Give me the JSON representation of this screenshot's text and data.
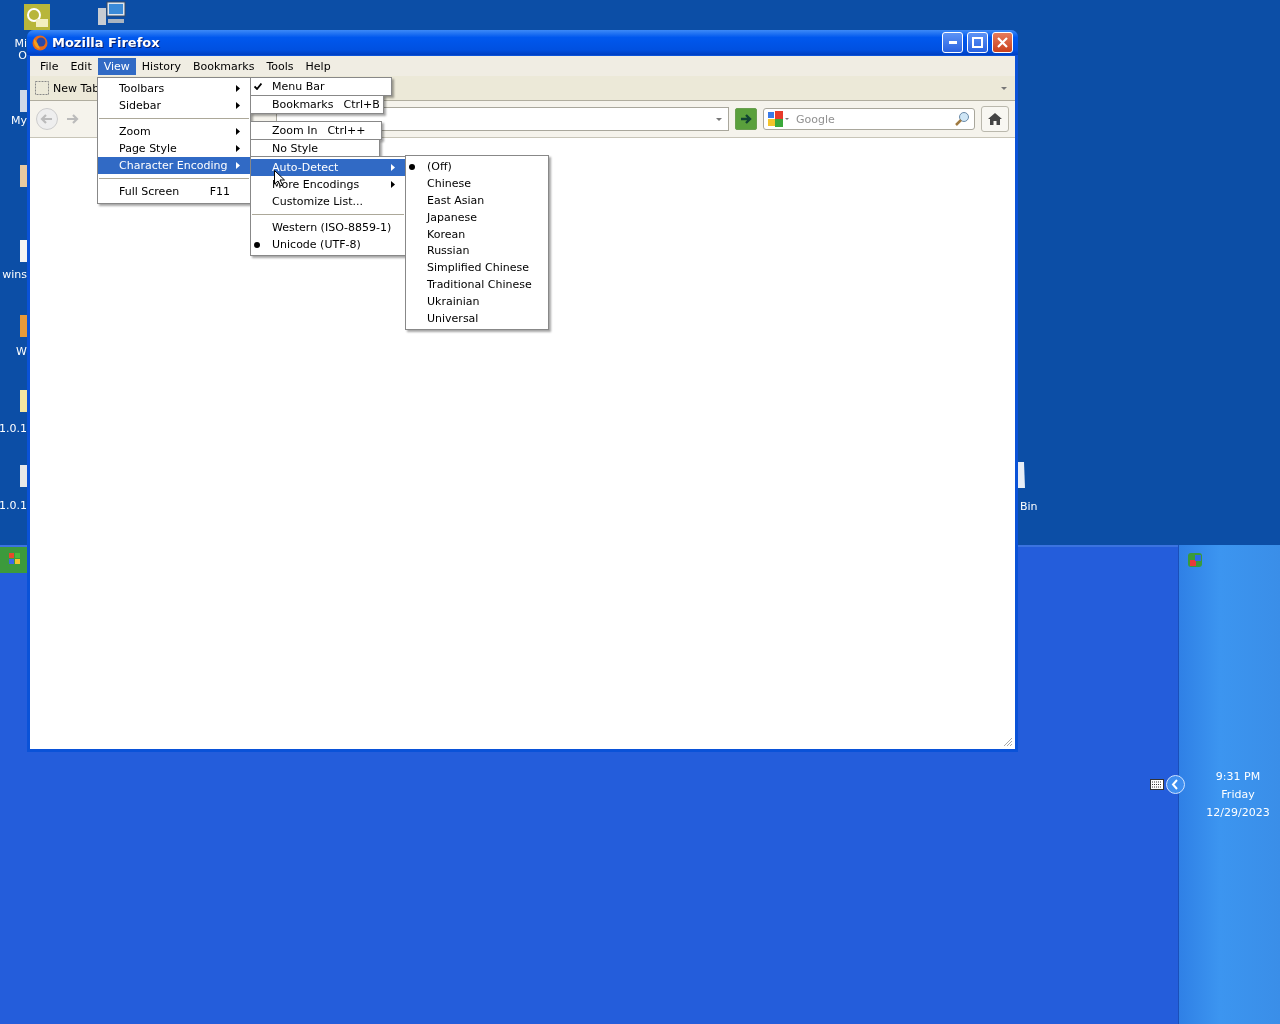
{
  "desktop_icons": [
    {
      "lines": [
        "Mi",
        "O"
      ]
    },
    {
      "lines": [
        "My"
      ]
    },
    {
      "lines": [
        "wins"
      ]
    },
    {
      "lines": [
        "W"
      ]
    },
    {
      "lines": [
        "1.0.1"
      ]
    },
    {
      "lines": [
        "1.0.1"
      ]
    }
  ],
  "recycle_bin": {
    "label": "Bin"
  },
  "window": {
    "title": "Mozilla Firefox",
    "menu_bar": [
      {
        "label": "File",
        "selected": false
      },
      {
        "label": "Edit",
        "selected": false
      },
      {
        "label": "View",
        "selected": true
      },
      {
        "label": "History",
        "selected": false
      },
      {
        "label": "Bookmarks",
        "selected": false
      },
      {
        "label": "Tools",
        "selected": false
      },
      {
        "label": "Help",
        "selected": false
      }
    ],
    "tab": {
      "label": "New Tab"
    },
    "search": {
      "placeholder": "Google"
    }
  },
  "view_menu": [
    {
      "kind": "item",
      "label": "Toolbars",
      "submenu": true,
      "selected": false
    },
    {
      "kind": "item",
      "label": "Sidebar",
      "submenu": true,
      "selected": false
    },
    {
      "kind": "separator"
    },
    {
      "kind": "item",
      "label": "Zoom",
      "submenu": true,
      "selected": false
    },
    {
      "kind": "item",
      "label": "Page Style",
      "submenu": true,
      "selected": false
    },
    {
      "kind": "item",
      "label": "Character Encoding",
      "submenu": true,
      "selected": true
    },
    {
      "kind": "separator"
    },
    {
      "kind": "item",
      "label": "Full Screen",
      "shortcut": "F11",
      "submenu": false,
      "selected": false
    }
  ],
  "leftover_menu_items": [
    {
      "label": "Menu Bar",
      "checked": true
    },
    {
      "label": "Bookmarks",
      "shortcut": "Ctrl+B",
      "checked": false
    },
    {
      "label": "Zoom In",
      "shortcut": "Ctrl++",
      "checked": false
    },
    {
      "label": "No Style",
      "checked": false
    }
  ],
  "encoding_menu": [
    {
      "kind": "item",
      "label": "Auto-Detect",
      "submenu": true,
      "selected": true,
      "checked": false
    },
    {
      "kind": "item",
      "label": "More Encodings",
      "submenu": true,
      "selected": false,
      "checked": false
    },
    {
      "kind": "item",
      "label": "Customize List...",
      "submenu": false,
      "selected": false,
      "checked": false
    },
    {
      "kind": "separator"
    },
    {
      "kind": "item",
      "label": "Western (ISO-8859-1)",
      "submenu": false,
      "selected": false,
      "checked": false
    },
    {
      "kind": "item",
      "label": "Unicode (UTF-8)",
      "submenu": false,
      "selected": false,
      "checked": true
    }
  ],
  "auto_detect_menu": [
    {
      "label": "(Off)",
      "checked": true
    },
    {
      "label": "Chinese",
      "checked": false
    },
    {
      "label": "East Asian",
      "checked": false
    },
    {
      "label": "Japanese",
      "checked": false
    },
    {
      "label": "Korean",
      "checked": false
    },
    {
      "label": "Russian",
      "checked": false
    },
    {
      "label": "Simplified Chinese",
      "checked": false
    },
    {
      "label": "Traditional Chinese",
      "checked": false
    },
    {
      "label": "Ukrainian",
      "checked": false
    },
    {
      "label": "Universal",
      "checked": false
    }
  ],
  "clock": {
    "time": "9:31 PM",
    "day": "Friday",
    "date": "12/29/2023"
  }
}
